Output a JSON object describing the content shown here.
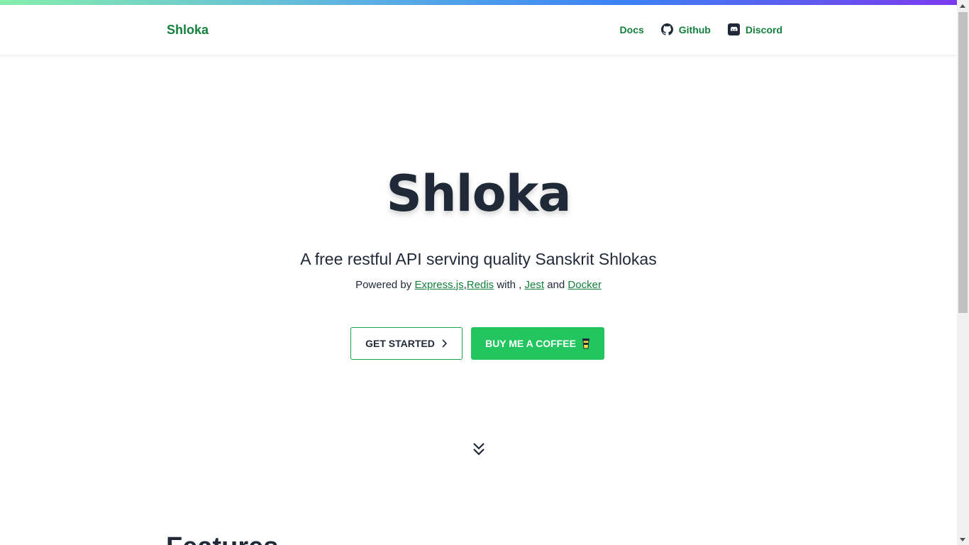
{
  "colors": {
    "brand_green": "#15803d",
    "button_green": "#22c55e",
    "text_dark": "#1f2937"
  },
  "navbar": {
    "brand": "Shloka",
    "links": [
      {
        "label": "Docs",
        "icon": ""
      },
      {
        "label": "Github",
        "icon": "github-icon"
      },
      {
        "label": "Discord",
        "icon": "discord-icon"
      }
    ]
  },
  "hero": {
    "title": "Shloka",
    "tagline": "A free restful API serving quality Sanskrit Shlokas",
    "powered_prefix": "Powered by",
    "tech": [
      "Express.js",
      "Redis",
      "Jest",
      "Docker"
    ],
    "sep_comma": ",",
    "with_text": "with ,",
    "and_text": "and"
  },
  "buttons": {
    "get_started": "GET STARTED",
    "coffee": "BUY ME A COFFEE"
  },
  "features": {
    "heading": "Features"
  }
}
